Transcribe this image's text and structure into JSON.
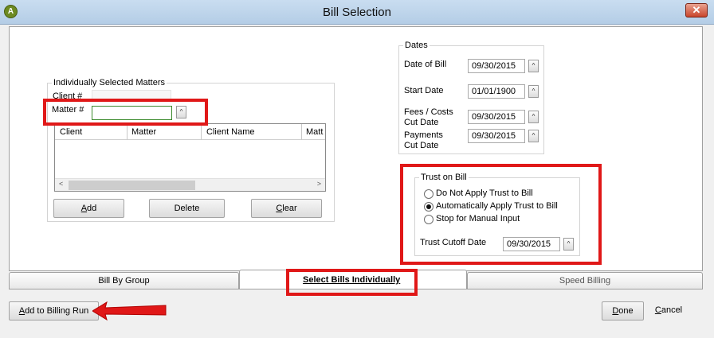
{
  "window": {
    "title": "Bill Selection",
    "app_icon_letter": "A",
    "close_glyph": "✕"
  },
  "matters": {
    "legend": "Individually Selected Matters",
    "client_label": "Client #",
    "matter_label": "Matter #",
    "matter_value": "",
    "spin_glyph": "^",
    "columns": [
      "Client",
      "Matter",
      "Client Name",
      "Matt"
    ],
    "scroll_left": "<",
    "scroll_right": ">",
    "add_button": "Add",
    "delete_button": "Delete",
    "clear_button": "Clear"
  },
  "dates": {
    "legend": "Dates",
    "date_of_bill_label": "Date of Bill",
    "date_of_bill": "09/30/2015",
    "start_date_label": "Start Date",
    "start_date": "01/01/1900",
    "fees_label_1": "Fees / Costs",
    "fees_label_2": "Cut Date",
    "fees_date": "09/30/2015",
    "payments_label_1": "Payments",
    "payments_label_2": "Cut Date",
    "payments_date": "09/30/2015"
  },
  "trust": {
    "legend": "Trust on Bill",
    "options": [
      "Do Not Apply Trust to Bill",
      "Automatically Apply Trust to Bill",
      "Stop for Manual Input"
    ],
    "selected_index": 1,
    "cutoff_label": "Trust Cutoff Date",
    "cutoff_date": "09/30/2015"
  },
  "tabs": [
    "Bill By Group",
    "Select Bills Individually",
    "Speed Billing"
  ],
  "footer": {
    "add_to_run": "Add to Billing Run",
    "done": "Done",
    "cancel": "Cancel"
  },
  "colors": {
    "highlight": "#e01818",
    "accent_icon": "#6d8a22"
  }
}
